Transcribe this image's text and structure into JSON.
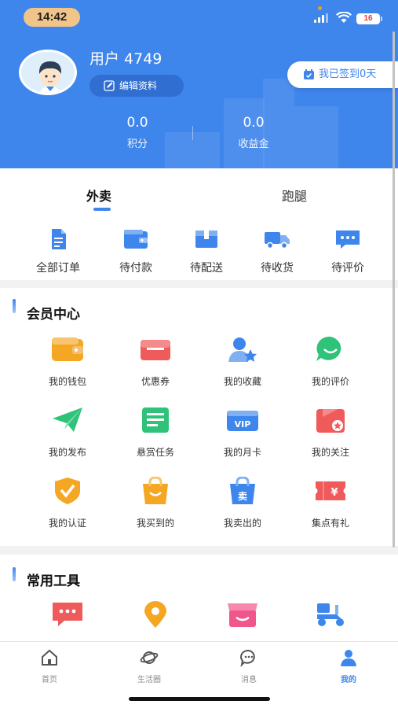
{
  "status_bar": {
    "time": "14:42",
    "battery": "16"
  },
  "profile": {
    "username": "用户 4749",
    "edit_label": "编辑资料",
    "checkin_label": "我已签到0天"
  },
  "stats": [
    {
      "value": "0.0",
      "label": "积分"
    },
    {
      "value": "0.0",
      "label": "收益金"
    }
  ],
  "order_tabs": [
    {
      "label": "外卖",
      "active": true
    },
    {
      "label": "跑腿",
      "active": false
    }
  ],
  "order_items": [
    {
      "label": "全部订单",
      "icon": "document-icon"
    },
    {
      "label": "待付款",
      "icon": "wallet-icon"
    },
    {
      "label": "待配送",
      "icon": "box-icon"
    },
    {
      "label": "待收货",
      "icon": "truck-icon"
    },
    {
      "label": "待评价",
      "icon": "comment-icon"
    }
  ],
  "member_center": {
    "title": "会员中心",
    "items": [
      {
        "label": "我的钱包",
        "icon": "wallet-icon"
      },
      {
        "label": "优惠券",
        "icon": "coupon-icon"
      },
      {
        "label": "我的收藏",
        "icon": "favorite-user-icon"
      },
      {
        "label": "我的评价",
        "icon": "smile-chat-icon"
      },
      {
        "label": "我的发布",
        "icon": "paper-plane-icon"
      },
      {
        "label": "悬赏任务",
        "icon": "task-card-icon"
      },
      {
        "label": "我的月卡",
        "icon": "vip-card-icon"
      },
      {
        "label": "我的关注",
        "icon": "follow-bag-icon"
      },
      {
        "label": "我的认证",
        "icon": "shield-check-icon"
      },
      {
        "label": "我买到的",
        "icon": "shopping-bag-icon"
      },
      {
        "label": "我卖出的",
        "icon": "sell-bag-icon"
      },
      {
        "label": "集点有礼",
        "icon": "ticket-yen-icon"
      }
    ]
  },
  "tools": {
    "title": "常用工具",
    "items": [
      {
        "icon": "chat-bubble-icon"
      },
      {
        "icon": "location-pin-icon"
      },
      {
        "icon": "store-icon"
      },
      {
        "icon": "scooter-icon"
      }
    ]
  },
  "bottom_nav": [
    {
      "label": "首页",
      "icon": "home-icon",
      "active": false
    },
    {
      "label": "生活圈",
      "icon": "planet-icon",
      "active": false
    },
    {
      "label": "消息",
      "icon": "message-icon",
      "active": false
    },
    {
      "label": "我的",
      "icon": "user-icon",
      "active": true
    }
  ],
  "colors": {
    "brand": "#3f86ec",
    "accent_orange": "#f5a623",
    "accent_red": "#ef5a5a",
    "accent_green": "#2fc37a"
  }
}
